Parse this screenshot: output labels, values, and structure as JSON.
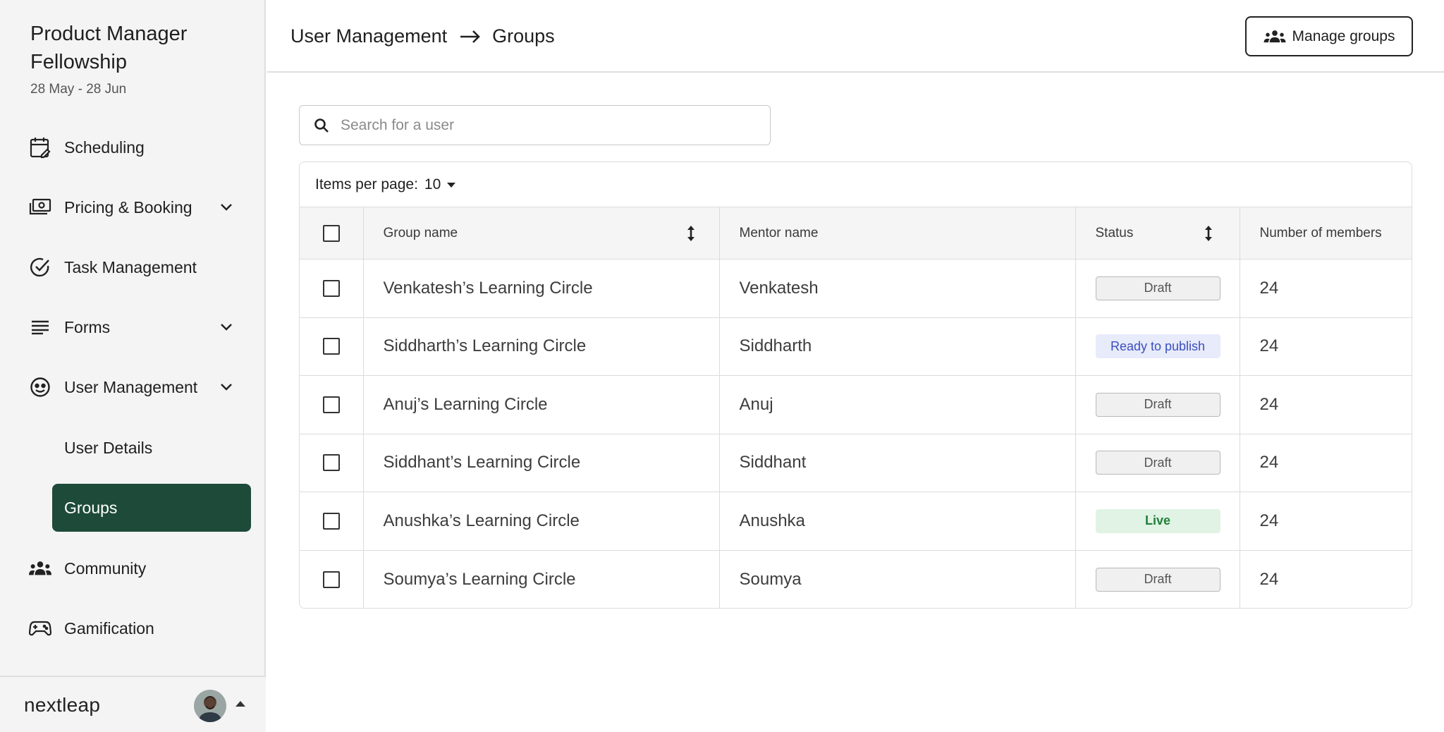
{
  "sidebar": {
    "program_title": "Product Manager Fellowship",
    "program_dates": "28 May - 28 Jun",
    "nav": {
      "scheduling": "Scheduling",
      "pricing": "Pricing & Booking",
      "tasks": "Task Management",
      "forms": "Forms",
      "user_management": "User Management",
      "user_details": "User Details",
      "groups": "Groups",
      "community": "Community",
      "gamification": "Gamification"
    },
    "logo": "nextleap"
  },
  "header": {
    "breadcrumb_parent": "User Management",
    "breadcrumb_current": "Groups",
    "manage_groups_label": "Manage groups"
  },
  "search": {
    "placeholder": "Search for a user",
    "value": ""
  },
  "table": {
    "items_per_page_label": "Items per page:",
    "items_per_page_value": "10",
    "columns": {
      "group_name": "Group name",
      "mentor_name": "Mentor name",
      "status": "Status",
      "members": "Number of members"
    },
    "rows": [
      {
        "group": "Venkatesh’s Learning Circle",
        "mentor": "Venkatesh",
        "status": "Draft",
        "members": "24"
      },
      {
        "group": "Siddharth’s Learning Circle",
        "mentor": "Siddharth",
        "status": "Ready to publish",
        "members": "24"
      },
      {
        "group": "Anuj’s Learning Circle",
        "mentor": "Anuj",
        "status": "Draft",
        "members": "24"
      },
      {
        "group": "Siddhant’s Learning Circle",
        "mentor": "Siddhant",
        "status": "Draft",
        "members": "24"
      },
      {
        "group": "Anushka’s Learning Circle",
        "mentor": "Anushka",
        "status": "Live",
        "members": "24"
      },
      {
        "group": "Soumya’s Learning Circle",
        "mentor": "Soumya",
        "status": "Draft",
        "members": "24"
      }
    ]
  },
  "colors": {
    "active_nav": "#1e4a3a",
    "draft_bg": "#f0f0f0",
    "ready_bg": "#e7ebfa",
    "ready_text": "#3b4fbf",
    "live_bg": "#e0f3e5",
    "live_text": "#23803b"
  }
}
